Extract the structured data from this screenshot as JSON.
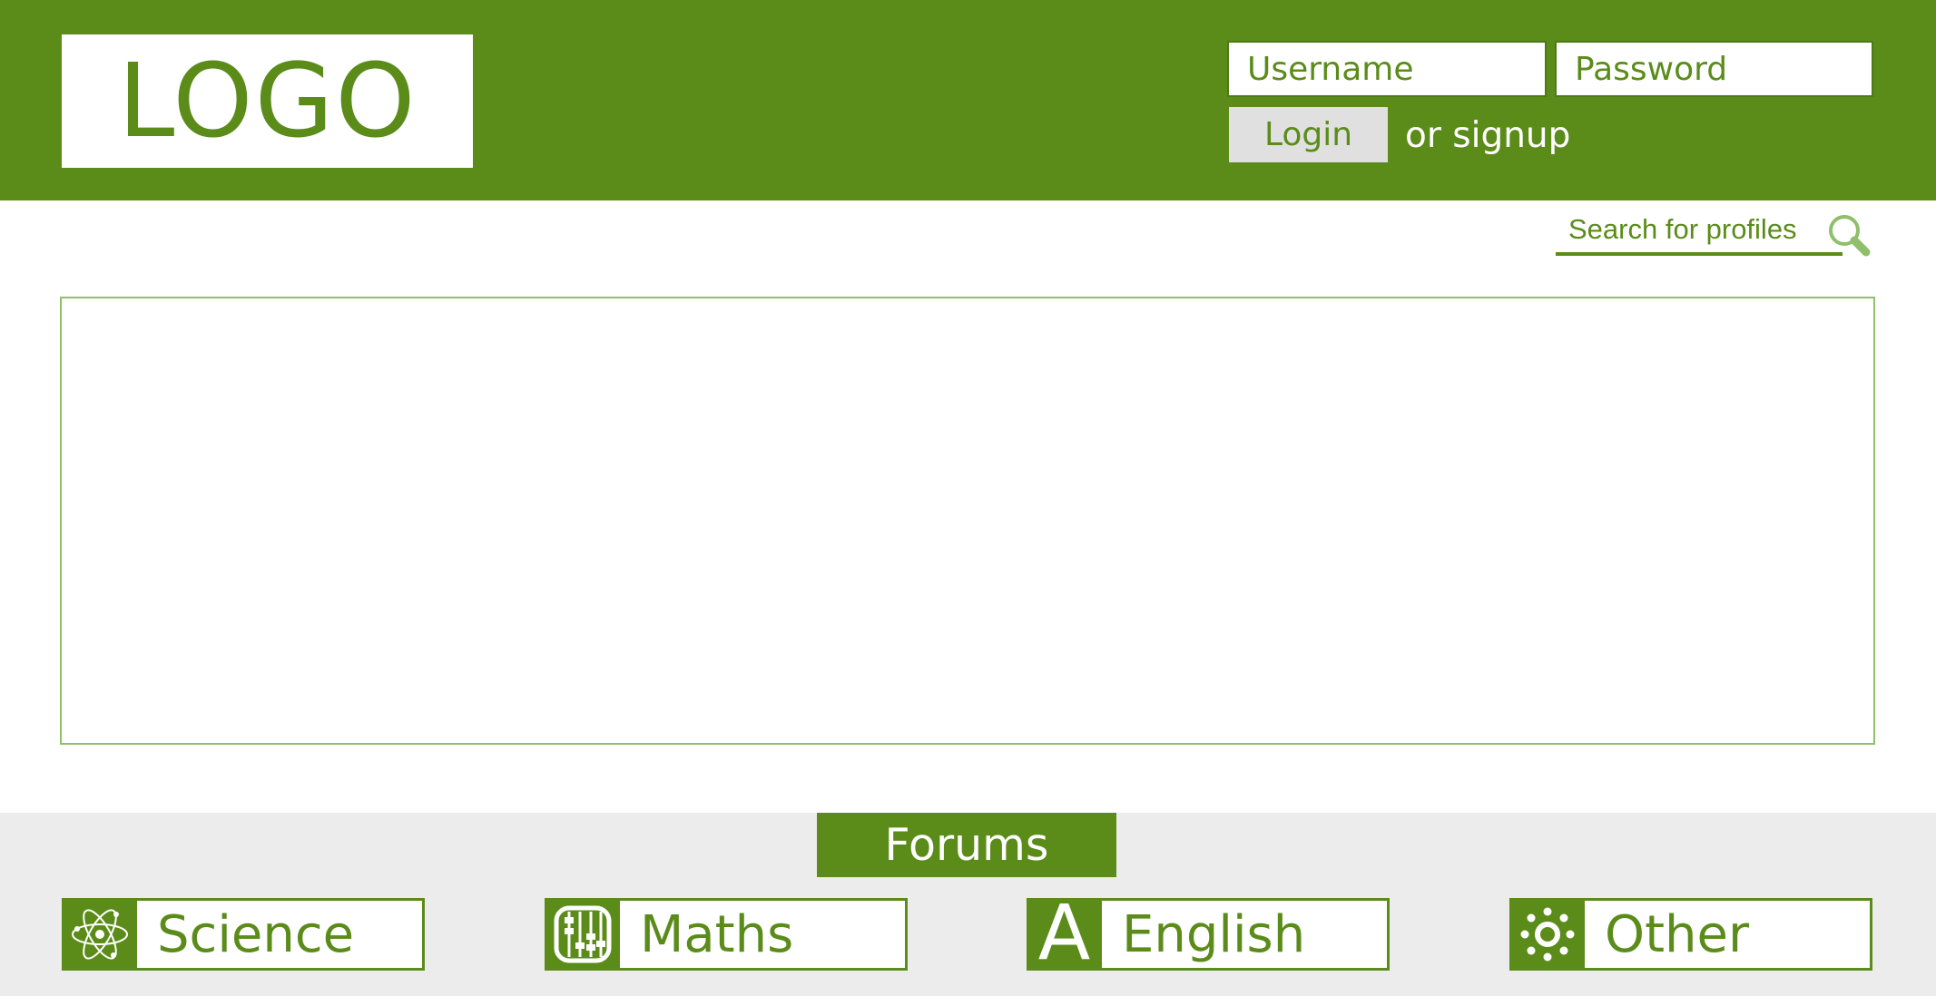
{
  "header": {
    "logo_text": "LOGO",
    "username_placeholder": "Username",
    "password_placeholder": "Password",
    "login_label": "Login",
    "signup_text": "or signup"
  },
  "search": {
    "placeholder": "Search for profiles",
    "icon": "search-icon"
  },
  "forums": {
    "title": "Forums",
    "categories": [
      {
        "label": "Science",
        "icon": "atom-icon"
      },
      {
        "label": "Maths",
        "icon": "abacus-icon"
      },
      {
        "label": "English",
        "icon": "letter-a-icon",
        "icon_text": "A"
      },
      {
        "label": "Other",
        "icon": "sun-icon"
      }
    ]
  },
  "colors": {
    "brand_green": "#5b8c1a",
    "light_green_border": "#8fc069",
    "footer_gray": "#ececec",
    "button_gray": "#e0e0e0"
  }
}
